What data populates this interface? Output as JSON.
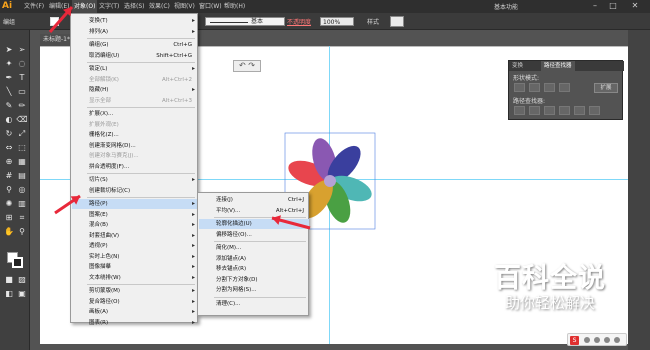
{
  "app": {
    "logo": "Ai"
  },
  "menubar": {
    "items": [
      "文件(F)",
      "编辑(E)",
      "对象(O)",
      "文字(T)",
      "选择(S)",
      "效果(C)",
      "视图(V)",
      "窗口(W)",
      "帮助(H)"
    ],
    "workspace": "基本功能"
  },
  "controlbar": {
    "selection_label": "编组",
    "stroke_style": "基本",
    "opacity_label": "不透明度",
    "opacity_value": "100%",
    "style_label": "样式"
  },
  "document": {
    "tab_title": "未标题-1* @ 150% (RGB/预览)",
    "tab2_title": ""
  },
  "object_menu": {
    "items": [
      {
        "label": "变换(T)",
        "shortcut": "",
        "submenu": true,
        "disabled": false
      },
      {
        "label": "排列(A)",
        "shortcut": "",
        "submenu": true,
        "disabled": false
      },
      {
        "label": "编组(G)",
        "shortcut": "Ctrl+G",
        "submenu": false,
        "disabled": false
      },
      {
        "label": "取消编组(U)",
        "shortcut": "Shift+Ctrl+G",
        "submenu": false,
        "disabled": false
      },
      {
        "label": "锁定(L)",
        "shortcut": "",
        "submenu": true,
        "disabled": false
      },
      {
        "label": "全部解锁(K)",
        "shortcut": "Alt+Ctrl+2",
        "submenu": false,
        "disabled": true
      },
      {
        "label": "隐藏(H)",
        "shortcut": "",
        "submenu": true,
        "disabled": false
      },
      {
        "label": "显示全部",
        "shortcut": "Alt+Ctrl+3",
        "submenu": false,
        "disabled": true
      },
      {
        "label": "扩展(X)...",
        "shortcut": "",
        "submenu": false,
        "disabled": false
      },
      {
        "label": "扩展外观(E)",
        "shortcut": "",
        "submenu": false,
        "disabled": true
      },
      {
        "label": "栅格化(Z)...",
        "shortcut": "",
        "submenu": false,
        "disabled": false
      },
      {
        "label": "创建渐变网格(D)...",
        "shortcut": "",
        "submenu": false,
        "disabled": false
      },
      {
        "label": "创建对象马赛克(J)...",
        "shortcut": "",
        "submenu": false,
        "disabled": true
      },
      {
        "label": "拼合透明度(F)...",
        "shortcut": "",
        "submenu": false,
        "disabled": false
      },
      {
        "label": "切片(S)",
        "shortcut": "",
        "submenu": true,
        "disabled": false
      },
      {
        "label": "创建裁切标记(C)",
        "shortcut": "",
        "submenu": false,
        "disabled": false
      },
      {
        "label": "路径(P)",
        "shortcut": "",
        "submenu": true,
        "disabled": false,
        "highlight": true
      },
      {
        "label": "图案(E)",
        "shortcut": "",
        "submenu": true,
        "disabled": false
      },
      {
        "label": "混合(B)",
        "shortcut": "",
        "submenu": true,
        "disabled": false
      },
      {
        "label": "封套扭曲(V)",
        "shortcut": "",
        "submenu": true,
        "disabled": false
      },
      {
        "label": "透视(P)",
        "shortcut": "",
        "submenu": true,
        "disabled": false
      },
      {
        "label": "实时上色(N)",
        "shortcut": "",
        "submenu": true,
        "disabled": false
      },
      {
        "label": "图像描摹",
        "shortcut": "",
        "submenu": true,
        "disabled": false
      },
      {
        "label": "文本绕排(W)",
        "shortcut": "",
        "submenu": true,
        "disabled": false
      },
      {
        "label": "剪切蒙版(M)",
        "shortcut": "",
        "submenu": true,
        "disabled": false
      },
      {
        "label": "复合路径(O)",
        "shortcut": "",
        "submenu": true,
        "disabled": false
      },
      {
        "label": "画板(A)",
        "shortcut": "",
        "submenu": true,
        "disabled": false
      },
      {
        "label": "图表(R)",
        "shortcut": "",
        "submenu": true,
        "disabled": false
      }
    ]
  },
  "path_submenu": {
    "items": [
      {
        "label": "连接(J)",
        "shortcut": "Ctrl+J"
      },
      {
        "label": "平均(V)...",
        "shortcut": "Alt+Ctrl+J"
      },
      {
        "label": "轮廓化描边(U)",
        "shortcut": "",
        "highlight": true
      },
      {
        "label": "偏移路径(O)...",
        "shortcut": ""
      },
      {
        "label": "简化(M)...",
        "shortcut": ""
      },
      {
        "label": "添加锚点(A)",
        "shortcut": ""
      },
      {
        "label": "移去锚点(R)",
        "shortcut": ""
      },
      {
        "label": "分割下方对象(D)",
        "shortcut": ""
      },
      {
        "label": "分割为网格(S)...",
        "shortcut": ""
      },
      {
        "label": "清理(C)...",
        "shortcut": ""
      }
    ]
  },
  "pathfinder": {
    "tab1": "变换",
    "tab2": "路径查找器",
    "shape_modes_label": "形状模式:",
    "pathfinders_label": "路径查找器:",
    "expand_label": "扩展"
  },
  "watermark": {
    "title": "百科全说",
    "subtitle": "助你轻松解决"
  },
  "flower": {
    "petal_colors": [
      "#e8454e",
      "#8a58b2",
      "#3a3f9e",
      "#4fb7b5",
      "#4aa043",
      "#d8a12f"
    ],
    "center_color": "#b5a1d6"
  },
  "colors": {
    "arrow_red": "#e8283a",
    "guide_cyan": "#7fd8f8",
    "selection_blue": "#4f7fe0"
  },
  "tray": {
    "icon_label": "S"
  }
}
